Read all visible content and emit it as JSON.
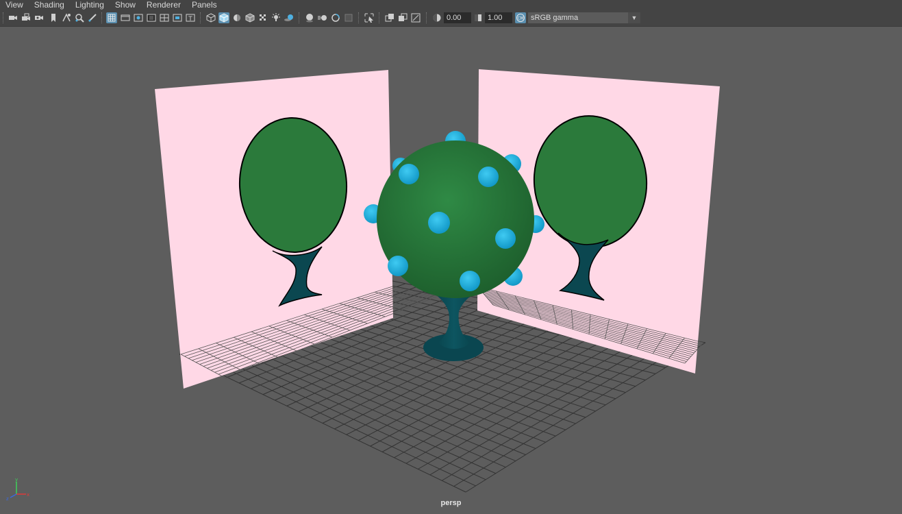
{
  "menu": [
    "View",
    "Shading",
    "Lighting",
    "Show",
    "Renderer",
    "Panels"
  ],
  "toolbar": {
    "exposure": "0.00",
    "gamma": "1.00",
    "colorspace": "sRGB gamma"
  },
  "viewport": {
    "camera_label": "persp"
  },
  "axis": {
    "x": "x",
    "y": "y",
    "z": "z"
  },
  "colors": {
    "menubar_bg": "#444444",
    "viewport_bg": "#5d5d5d",
    "card_pink": "#ffd8e6",
    "tree_green": "#2b7a3b",
    "trunk_teal": "#0b4750",
    "ornament_blue": "#1fb0dd",
    "selected_tool": "#5a8fb0"
  }
}
